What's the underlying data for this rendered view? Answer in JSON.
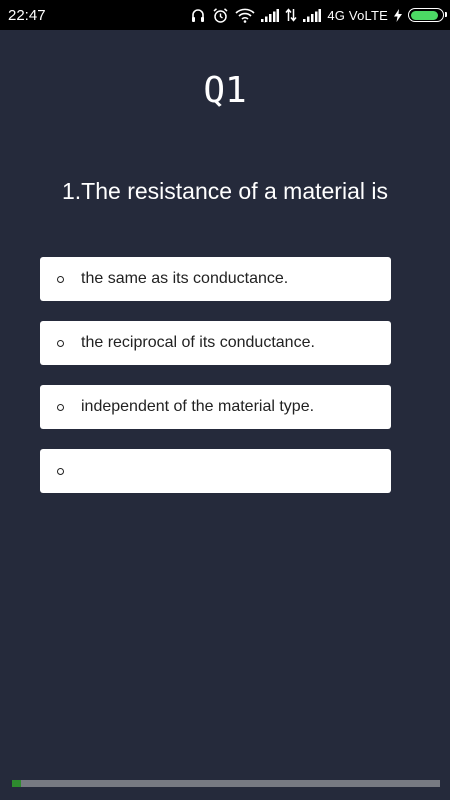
{
  "status_bar": {
    "time": "22:47",
    "network_label": "4G VoLTE",
    "battery_level": 0.9,
    "battery_color": "#4cd964",
    "icons": [
      "headphones-icon",
      "alarm-icon",
      "wifi-icon",
      "signal-icon",
      "data-transfer-icon",
      "signal-icon",
      "charging-icon",
      "battery-icon"
    ]
  },
  "quiz": {
    "title": "Q1",
    "question": "1.The resistance of a material is",
    "options": [
      "the same as its conductance.",
      "the reciprocal of its conductance.",
      "independent of the material type.",
      ""
    ],
    "progress": 0.02,
    "progress_color": "#2e8b2e"
  },
  "colors": {
    "background": "#252a3b",
    "card": "#ffffff"
  }
}
